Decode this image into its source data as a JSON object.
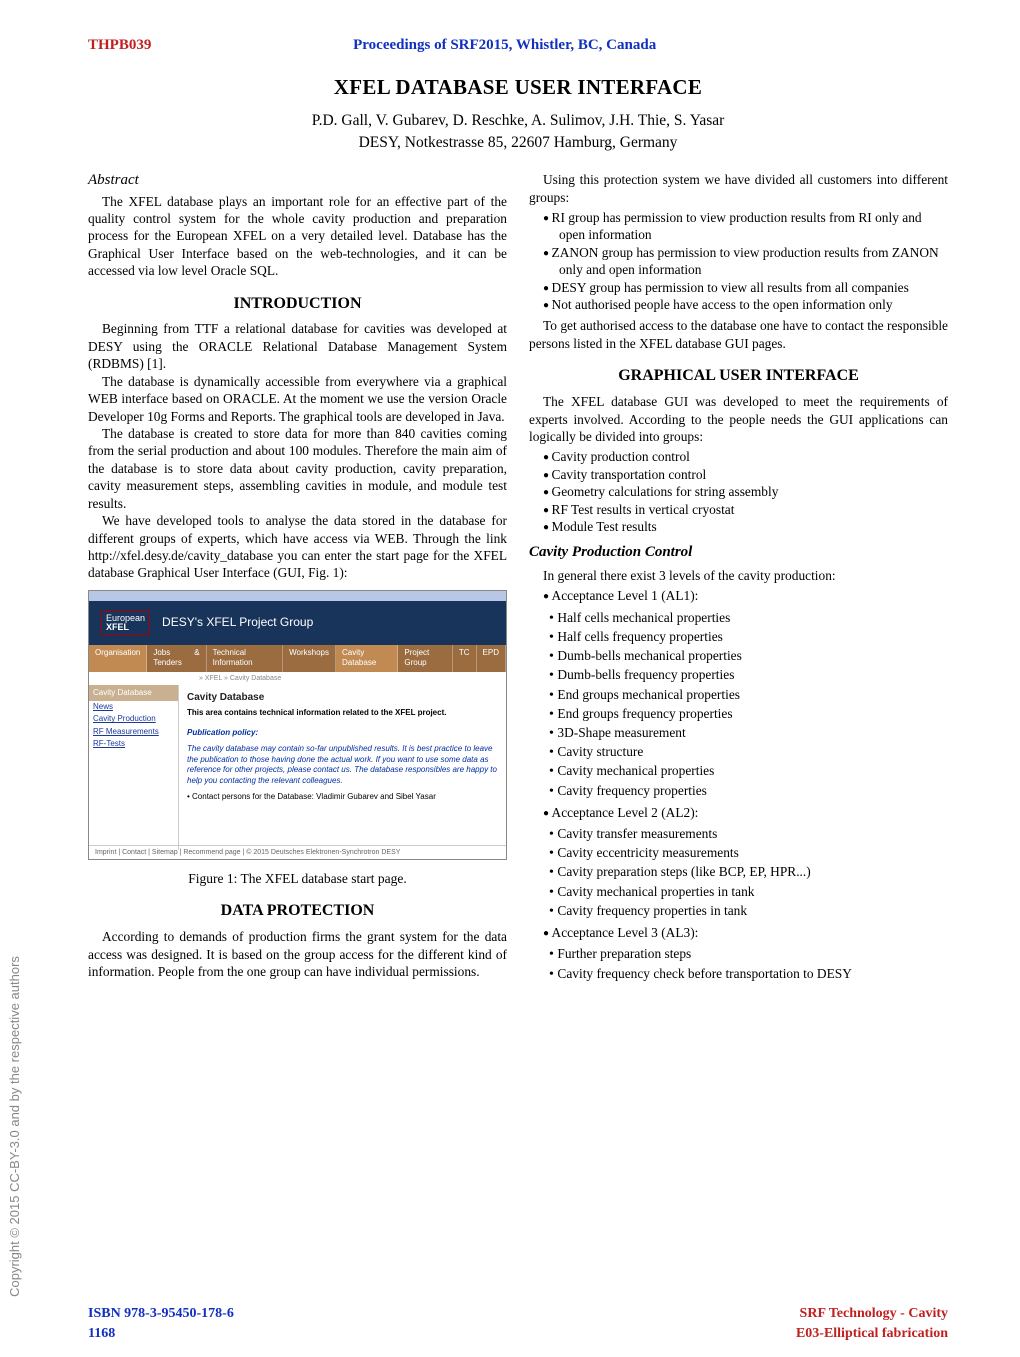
{
  "header": {
    "paper_code": "THPB039",
    "proceedings": "Proceedings of SRF2015, Whistler, BC, Canada"
  },
  "title": "XFEL DATABASE USER INTERFACE",
  "authors": "P.D. Gall, V.  Gubarev, D. Reschke, A. Sulimov, J.H. Thie, S. Yasar",
  "affiliation": "DESY, Notkestrasse 85, 22607 Hamburg, Germany",
  "abstract_heading": "Abstract",
  "abstract_text": "The XFEL database plays an important role for an effective part of the quality control system for the whole cavity production and preparation process for the European XFEL on a very detailed level. Database has the Graphical User Interface based on the web-technologies, and it can be accessed via low level Oracle SQL.",
  "sections": {
    "intro_heading": "INTRODUCTION",
    "intro_p1": "Beginning from TTF a relational database for cavities was developed at DESY using the ORACLE Relational Database Management System (RDBMS) [1].",
    "intro_p2": "The database is dynamically accessible from everywhere via a graphical WEB interface based on ORACLE. At the moment we use the version Oracle Developer 10g Forms and Reports. The graphical tools are developed in Java.",
    "intro_p3": "The database is created to store data for more than 840 cavities coming from the serial production and about 100 modules. Therefore the main aim of the database is to store data about cavity production, cavity preparation, cavity measurement steps, assembling cavities in module, and module test results.",
    "intro_p4": "We have developed tools to analyse the data stored in the database for different groups of experts, which have access via WEB. Through the link http://xfel.desy.de/cavity_database you can enter the start page for the XFEL database Graphical User Interface (GUI, Fig. 1):",
    "dp_heading": "DATA PROTECTION",
    "dp_p1": "According to demands of production firms the grant system for the data access was designed. It is based on the group access for the different kind of information. People from the one group can have individual permissions.",
    "dp_p2": "Using this protection system we have divided all customers into different groups:",
    "dp_list": [
      "RI group has permission to view production results from RI only and open information",
      "ZANON group has permission to view production results from ZANON only and open information",
      "DESY group  has permission to view all results from all companies",
      "Not authorised people have access to the open information only"
    ],
    "dp_p3": "To get authorised access to the database one have to contact the responsible persons listed in the XFEL database GUI pages.",
    "gui_heading": "GRAPHICAL USER INTERFACE",
    "gui_p1": "The XFEL database GUI was developed  to meet the requirements of experts involved. According to the people needs the GUI applications can logically be divided into groups:",
    "gui_list": [
      "Cavity production control",
      "Cavity transportation control",
      "Geometry calculations for string assembly",
      "RF Test results in vertical cryostat",
      "Module Test results"
    ],
    "cpc_heading": "Cavity Production Control",
    "cpc_p1": "In general there exist 3 levels of the cavity production:",
    "al1_label": "Acceptance Level 1 (AL1):",
    "al1_items": [
      "Half cells mechanical properties",
      "Half cells frequency properties",
      "Dumb-bells mechanical properties",
      "Dumb-bells frequency properties",
      "End groups mechanical properties",
      "End groups frequency properties",
      "3D-Shape measurement",
      "Cavity structure",
      "Cavity mechanical properties",
      "Cavity frequency properties"
    ],
    "al2_label": "Acceptance Level 2 (AL2):",
    "al2_items": [
      "Cavity transfer measurements",
      "Cavity eccentricity measurements",
      "Cavity preparation steps (like BCP, EP, HPR...)",
      "Cavity mechanical properties in tank",
      "Cavity frequency properties in tank"
    ],
    "al3_label": "Acceptance Level 3 (AL3):",
    "al3_items": [
      "Further preparation steps",
      "Cavity frequency check before transportation to DESY"
    ]
  },
  "figure1": {
    "logo_top": "European",
    "logo_bottom": "XFEL",
    "banner": "DESY's XFEL Project Group",
    "breadcrumb": "» XFEL » Cavity Database",
    "tabs": [
      "Organisation",
      "Jobs & Tenders",
      "Technical Information",
      "Workshops",
      "Cavity Database",
      "Project Group",
      "TC",
      "EPD"
    ],
    "sidebar_head": "Cavity Database",
    "sidebar_items": [
      "News",
      "Cavity Production",
      "RF Measurements",
      "RF-Tests"
    ],
    "main_title": "Cavity Database",
    "main_sub": "This area contains technical information related to the XFEL project.",
    "policy_label": "Publication policy:",
    "policy_text": "The cavity database may contain so-far unpublished results. It is best practice to leave the publication to those having done the actual work. If you want to use some data as reference for other projects, please contact us. The database responsibles are happy to help you contacting the relevant colleagues.",
    "contact_line": "• Contact persons for the Database: Vladimir Gubarev and Sibel Yasar",
    "footer": "Imprint | Contact | Sitemap | Recommend page | © 2015 Deutsches Elektronen-Synchrotron DESY",
    "caption": "Figure 1: The XFEL database start page."
  },
  "sidetext": "Copyright © 2015 CC-BY-3.0 and by the respective authors",
  "footer": {
    "isbn": "ISBN 978-3-95450-178-6",
    "pagenum": "1168",
    "cat1": "SRF Technology - Cavity",
    "cat2": "E03-Elliptical fabrication"
  }
}
